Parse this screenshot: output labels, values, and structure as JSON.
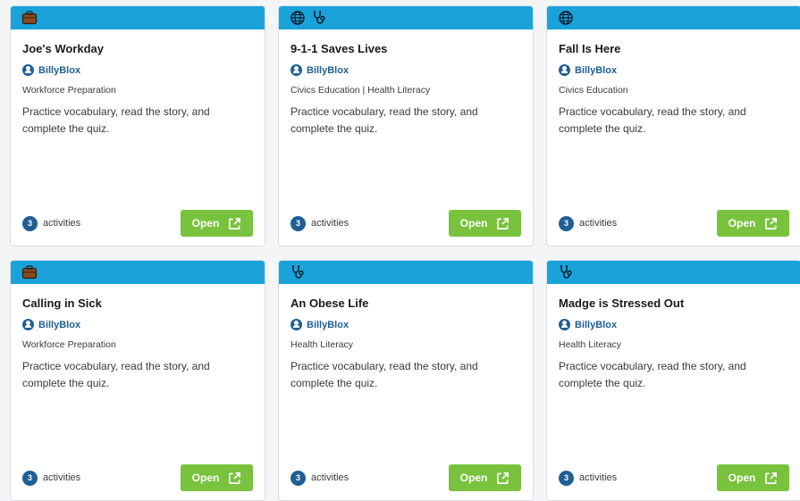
{
  "colors": {
    "header": "#1aa3db",
    "author": "#1f5f94",
    "open_button": "#78c23d"
  },
  "cards": [
    {
      "icons": [
        "briefcase-icon"
      ],
      "title": "Joe's Workday",
      "author": "BillyBlox",
      "category": "Workforce Preparation",
      "description": "Practice vocabulary, read the story, and complete the quiz.",
      "activity_count": "3",
      "activities_label": "activities",
      "open_label": "Open"
    },
    {
      "icons": [
        "globe-icon",
        "stethoscope-icon"
      ],
      "title": "9-1-1 Saves Lives",
      "author": "BillyBlox",
      "category": "Civics Education | Health Literacy",
      "description": "Practice vocabulary, read the story, and complete the quiz.",
      "activity_count": "3",
      "activities_label": "activities",
      "open_label": "Open"
    },
    {
      "icons": [
        "globe-icon"
      ],
      "title": "Fall Is Here",
      "author": "BillyBlox",
      "category": "Civics Education",
      "description": "Practice vocabulary, read the story, and complete the quiz.",
      "activity_count": "3",
      "activities_label": "activities",
      "open_label": "Open"
    },
    {
      "icons": [
        "briefcase-icon"
      ],
      "title": "Calling in Sick",
      "author": "BillyBlox",
      "category": "Workforce Preparation",
      "description": "Practice vocabulary, read the story, and complete the quiz.",
      "activity_count": "3",
      "activities_label": "activities",
      "open_label": "Open"
    },
    {
      "icons": [
        "stethoscope-icon"
      ],
      "title": "An Obese Life",
      "author": "BillyBlox",
      "category": "Health Literacy",
      "description": "Practice vocabulary, read the story, and complete the quiz.",
      "activity_count": "3",
      "activities_label": "activities",
      "open_label": "Open"
    },
    {
      "icons": [
        "stethoscope-icon"
      ],
      "title": "Madge is Stressed Out",
      "author": "BillyBlox",
      "category": "Health Literacy",
      "description": "Practice vocabulary, read the story, and complete the quiz.",
      "activity_count": "3",
      "activities_label": "activities",
      "open_label": "Open"
    }
  ]
}
